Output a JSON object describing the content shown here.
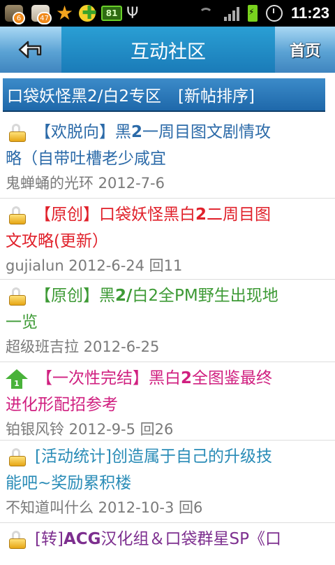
{
  "status_bar": {
    "notif_badge_1": "6",
    "notif_badge_2": "47",
    "battery_app_label": "81",
    "time": "11:23"
  },
  "header": {
    "title": "互动社区",
    "home_label": "首页",
    "back_icon": "back-arrow-icon"
  },
  "section": {
    "title": "口袋妖怪黑2/白2专区",
    "sort_label": "[新帖排序]"
  },
  "posts": [
    {
      "icon": "lock-icon",
      "color": "#2b6aa8",
      "title_1": "【欢脱向】黑",
      "title_2": "2",
      "title_3": "一周目图文剧情攻",
      "title_4": "略（自带吐槽老少咸宜",
      "meta": "鬼蝉蛹的光环  2012-7-6"
    },
    {
      "icon": "lock-icon",
      "color": "#e0202a",
      "title_1": "【原创】口袋妖怪黑白",
      "title_2": "2",
      "title_3": "二周目图",
      "title_4": "文攻略(更新）",
      "meta": "gujialun 2012-6-24 回11"
    },
    {
      "icon": "lock-icon",
      "color": "#3d9a35",
      "title_1": "【原创】黑",
      "title_2": "2/",
      "title_3": "白2全PM野生出现地",
      "title_4": "一览",
      "meta": "超级班吉拉  2012-6-25"
    },
    {
      "icon": "up-icon",
      "color": "#d02080",
      "title_1": "【一次性完结】黑白",
      "title_2": "2",
      "title_3": "全图鉴最终",
      "title_4": "进化形配招参考",
      "meta": "铂银风铃  2012-9-5 回26"
    },
    {
      "icon": "lock-icon",
      "color": "#2a8cb7",
      "title_1": "[活动统计]创造属于自己的升级技",
      "title_2": "",
      "title_3": "",
      "title_4": "能吧~奖励累积楼",
      "meta": "不知道叫什么  2012-10-3 回6"
    },
    {
      "icon": "lock-icon",
      "color": "#7d2f8f",
      "title_1": "[转]",
      "title_2": "ACG",
      "title_3": "汉化组＆口袋群星SP《口",
      "title_4": "",
      "meta": ""
    }
  ],
  "up_icon_number": "1"
}
